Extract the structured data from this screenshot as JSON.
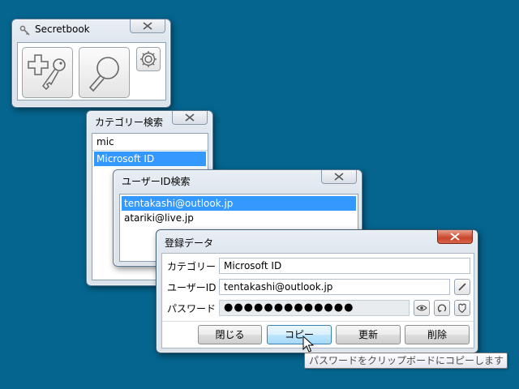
{
  "main_window": {
    "title": "Secretbook",
    "title_icon": "key-icon",
    "add_button_icon": "plus-key-icon",
    "search_button_icon": "magnifier-icon",
    "settings_button_icon": "gear-icon"
  },
  "category_search": {
    "title": "カテゴリー検索",
    "query": "mic",
    "items": [
      {
        "label": "Microsoft ID",
        "selected": true
      }
    ]
  },
  "userid_search": {
    "title": "ユーザーID検索",
    "items": [
      {
        "label": "tentakashi@outlook.jp",
        "selected": true
      },
      {
        "label": "atariki@live.jp",
        "selected": false
      }
    ]
  },
  "registration": {
    "title": "登録データ",
    "category_label": "カテゴリー",
    "category_value": "Microsoft ID",
    "userid_label": "ユーザーID",
    "userid_value": "tentakashi@outlook.jp",
    "password_label": "パスワード",
    "password_masked": "●●●●●●●●●●●●●",
    "buttons": {
      "close": "閉じる",
      "copy": "コピー",
      "update": "更新",
      "delete": "削除"
    }
  },
  "tooltip": {
    "text": "パスワードをクリップボードにコピーします"
  },
  "colors": {
    "desktop": "#05658f",
    "selection": "#3399ff",
    "close_active": "#c9452b"
  }
}
